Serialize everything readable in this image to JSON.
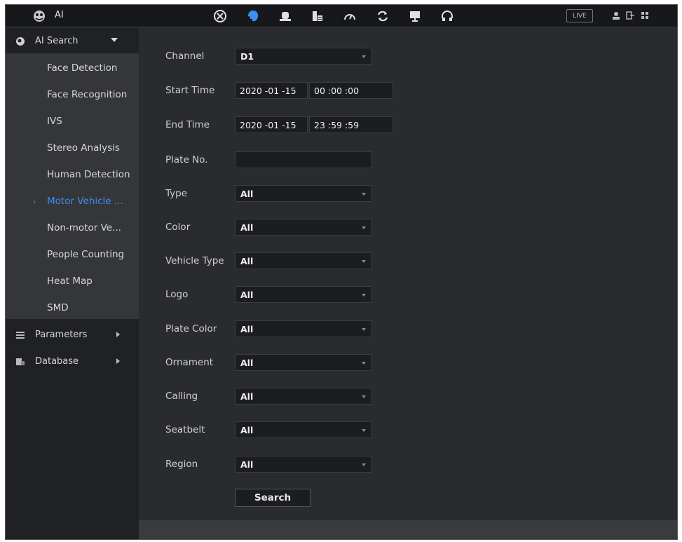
{
  "app": {
    "title": "AI",
    "live_label": "LIVE"
  },
  "topbar": {
    "icons": [
      "playback-icon",
      "ai-icon",
      "alarm-icon",
      "storage-icon",
      "performance-icon",
      "backup-icon",
      "display-icon",
      "audio-icon"
    ],
    "active_index": 1,
    "accent": "#3d8ef0"
  },
  "sidebar": {
    "ai_search": {
      "label": "AI Search"
    },
    "items": [
      {
        "label": "Face Detection"
      },
      {
        "label": "Face Recognition"
      },
      {
        "label": "IVS"
      },
      {
        "label": "Stereo Analysis"
      },
      {
        "label": "Human Detection"
      },
      {
        "label": "Motor Vehicle ...",
        "active": true
      },
      {
        "label": "Non-motor Ve..."
      },
      {
        "label": "People Counting"
      },
      {
        "label": "Heat Map"
      },
      {
        "label": "SMD"
      }
    ],
    "parameters": {
      "label": "Parameters"
    },
    "database": {
      "label": "Database"
    }
  },
  "form": {
    "channel": {
      "label": "Channel",
      "value": "D1"
    },
    "start_time": {
      "label": "Start Time",
      "date": "2020 -01 -15",
      "time": "00 :00 :00"
    },
    "end_time": {
      "label": "End Time",
      "date": "2020 -01 -15",
      "time": "23 :59 :59"
    },
    "plate_no": {
      "label": "Plate No.",
      "value": ""
    },
    "type": {
      "label": "Type",
      "value": "All"
    },
    "color": {
      "label": "Color",
      "value": "All"
    },
    "vehicle_type": {
      "label": "Vehicle Type",
      "value": "All"
    },
    "logo": {
      "label": "Logo",
      "value": "All"
    },
    "plate_color": {
      "label": "Plate Color",
      "value": "All"
    },
    "ornament": {
      "label": "Ornament",
      "value": "All"
    },
    "calling": {
      "label": "Calling",
      "value": "All"
    },
    "seatbelt": {
      "label": "Seatbelt",
      "value": "All"
    },
    "region": {
      "label": "Region",
      "value": "All"
    },
    "search_label": "Search"
  }
}
